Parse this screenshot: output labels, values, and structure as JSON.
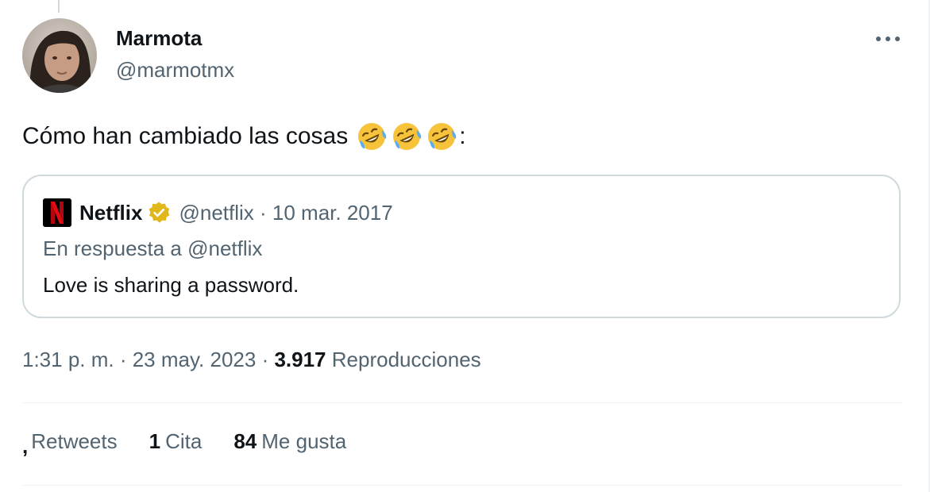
{
  "tweet": {
    "author": {
      "name": "Marmota",
      "handle": "@marmotmx"
    },
    "text": "Cómo han cambiado las cosas",
    "emojis": [
      "rofl-emoji",
      "rofl-emoji",
      "rofl-emoji"
    ],
    "text_suffix": ":",
    "timestamp": "1:31 p. m. · 23 may. 2023 · ",
    "views_count": "3.917",
    "views_label": "Reproducciones"
  },
  "quoted_tweet": {
    "author_name": "Netflix",
    "meta": "@netflix · 10 mar. 2017",
    "reply_to": "En respuesta a @netflix",
    "text": "Love is sharing a password.",
    "logo_letter": "N",
    "verified_badge_color": "#e2b719"
  },
  "stats": {
    "retweets_count": ",",
    "retweets_label": "Retweets",
    "quotes_count": "1",
    "quotes_label": "Cita",
    "likes_count": "84",
    "likes_label": "Me gusta"
  },
  "colors": {
    "text_primary": "#0f1419",
    "text_secondary": "#536471",
    "border": "#cfd9de",
    "netflix_red": "#e50914"
  }
}
